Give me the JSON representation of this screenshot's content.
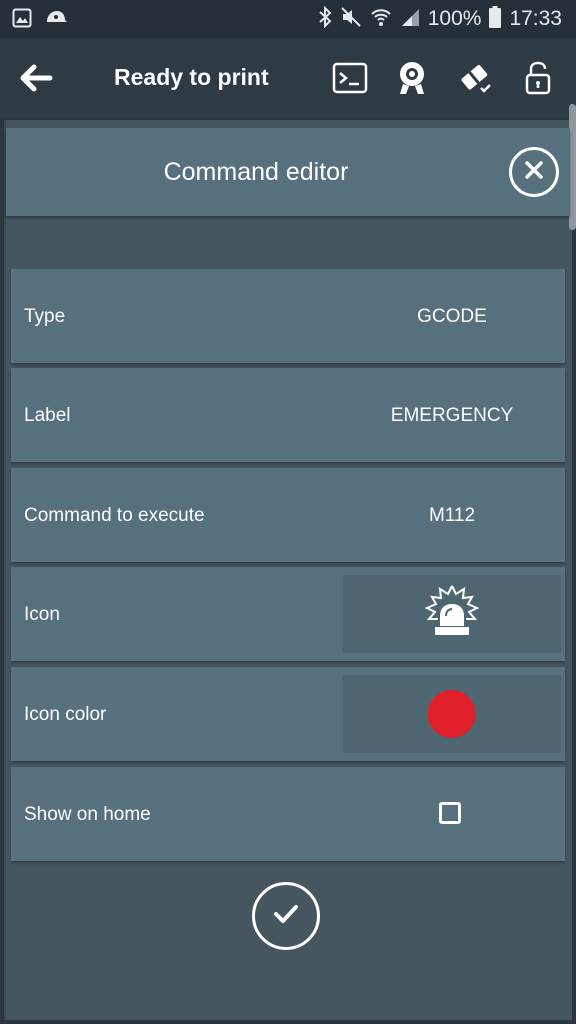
{
  "status_bar": {
    "left_icons": [
      "gallery-icon",
      "cap-icon"
    ],
    "right_icons": [
      "bluetooth-icon",
      "mute-icon",
      "wifi-icon",
      "signal-icon"
    ],
    "battery_percent": "100%",
    "battery_icon": "battery-full-icon",
    "time": "17:33"
  },
  "app_bar": {
    "back_icon": "arrow-left-icon",
    "title": "Ready to print",
    "actions": [
      "terminal-icon",
      "webcam-icon",
      "tool-check-icon",
      "lock-icon"
    ]
  },
  "dialog": {
    "title": "Command editor",
    "close_icon": "close-icon",
    "rows": [
      {
        "label": "Type",
        "value": "GCODE"
      },
      {
        "label": "Label",
        "value": "EMERGENCY"
      },
      {
        "label": "Command to execute",
        "value": "M112"
      },
      {
        "label": "Icon",
        "icon": "siren-icon"
      },
      {
        "label": "Icon color",
        "color": "#e0202a"
      },
      {
        "label": "Show on home",
        "checked": false
      }
    ],
    "confirm_icon": "check-icon"
  },
  "colors": {
    "status_bar_bg": "#263039",
    "app_bar_bg": "#2e3a44",
    "panel_bg": "#46565f",
    "row_bg": "#56707d",
    "icon_color_value": "#e0202a"
  }
}
